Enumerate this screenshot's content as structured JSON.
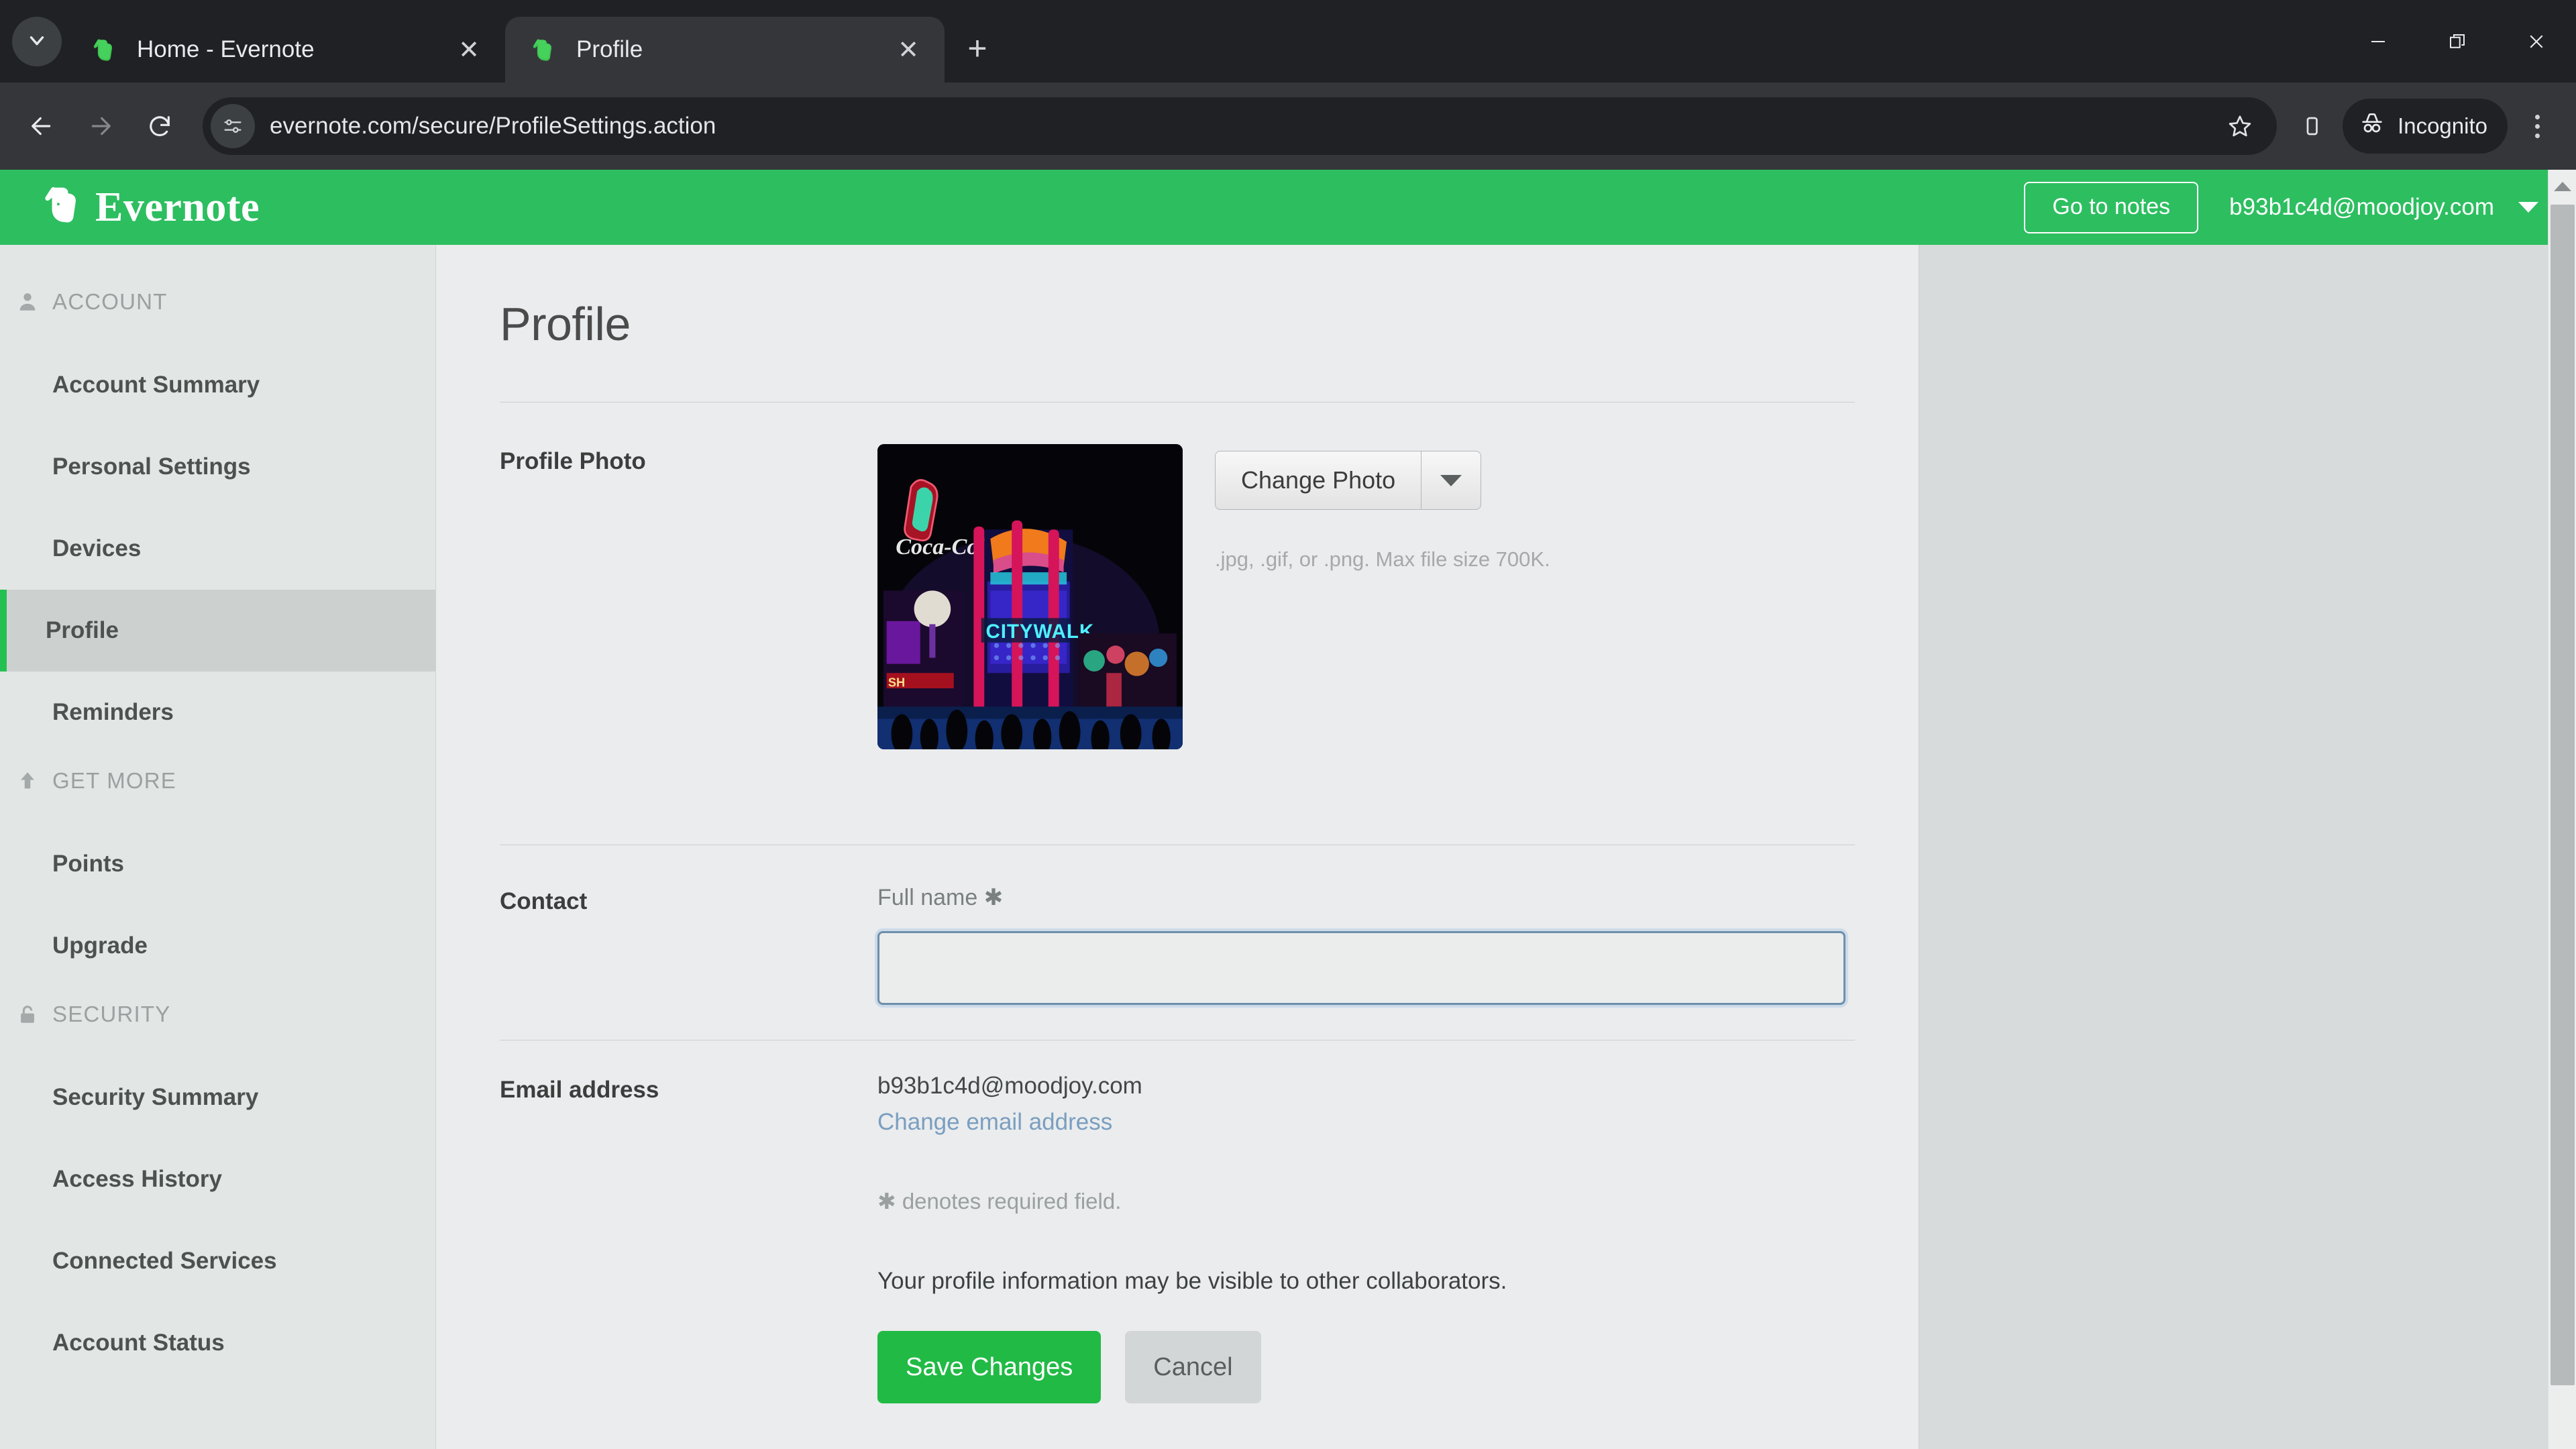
{
  "browser": {
    "tab_search_icon": "chevron-down-icon",
    "tabs": [
      {
        "title": "Home - Evernote",
        "favicon": "evernote-elephant-icon",
        "close_label": "×",
        "active": false
      },
      {
        "title": "Profile",
        "favicon": "evernote-elephant-icon",
        "close_label": "×",
        "active": true
      }
    ],
    "new_tab_label": "+",
    "window_controls": [
      "minimize-icon",
      "restore-icon",
      "close-icon"
    ],
    "nav": {
      "back": "back-arrow-icon",
      "forward": "forward-arrow-icon",
      "reload": "reload-icon"
    },
    "omnibox": {
      "site_info_icon": "site-settings-sliders-icon",
      "url": "evernote.com/secure/ProfileSettings.action",
      "bookmark_icon": "star-icon"
    },
    "side_panel_icon": "side-panel-icon",
    "incognito_label": "Incognito",
    "incognito_icon": "incognito-hat-icon",
    "menu_icon": "three-dot-menu-icon"
  },
  "header": {
    "brand": "Evernote",
    "logo_icon": "evernote-elephant-logo",
    "go_to_notes": "Go to notes",
    "account_email": "b93b1c4d@moodjoy.com",
    "caret_icon": "chevron-down-icon",
    "background_color": "#2dbe60"
  },
  "sidebar": {
    "groups": [
      {
        "label": "ACCOUNT",
        "icon": "person-icon",
        "items": [
          {
            "label": "Account Summary",
            "active": false
          },
          {
            "label": "Personal Settings",
            "active": false
          },
          {
            "label": "Devices",
            "active": false
          },
          {
            "label": "Profile",
            "active": true
          },
          {
            "label": "Reminders",
            "active": false
          }
        ]
      },
      {
        "label": "GET MORE",
        "icon": "up-arrow-icon",
        "items": [
          {
            "label": "Points",
            "active": false
          },
          {
            "label": "Upgrade",
            "active": false
          }
        ]
      },
      {
        "label": "SECURITY",
        "icon": "lock-icon",
        "items": [
          {
            "label": "Security Summary",
            "active": false
          },
          {
            "label": "Access History",
            "active": false
          },
          {
            "label": "Connected Services",
            "active": false
          },
          {
            "label": "Account Status",
            "active": false
          }
        ]
      }
    ],
    "active_indicator_color": "#23c052"
  },
  "main": {
    "title": "Profile",
    "photo_section": {
      "label": "Profile Photo",
      "photo_alt": "night neon cityscape with Coca-Cola sign and CITYWALK marquee",
      "photo_caption_texts": [
        "Coca-Cola",
        "CITYWALK"
      ],
      "change_photo_button": "Change Photo",
      "change_photo_caret": "chevron-down-icon",
      "hint": ".jpg, .gif, or .png. Max file size 700K."
    },
    "contact_section": {
      "label": "Contact",
      "full_name_label": "Full name",
      "required_marker": "✱",
      "full_name_value": "",
      "full_name_placeholder": ""
    },
    "email_section": {
      "label": "Email address",
      "value": "b93b1c4d@moodjoy.com",
      "change_link": "Change email address"
    },
    "footnotes": {
      "required": "✱ denotes required field.",
      "visibility": "Your profile information may be visible to other collaborators."
    },
    "actions": {
      "save": "Save Changes",
      "cancel": "Cancel",
      "save_color": "#21ba45"
    }
  },
  "scrollbar": {
    "up_arrow_icon": "triangle-up-icon"
  }
}
